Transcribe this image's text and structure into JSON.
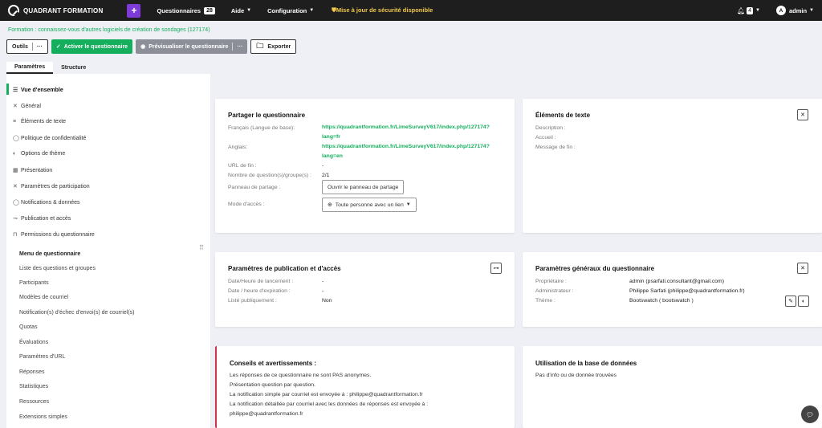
{
  "topbar": {
    "brand": "QUADRANT FORMATION",
    "plus": "+",
    "surveys_label": "Questionnaires",
    "surveys_count": "28",
    "help_label": "Aide",
    "config_label": "Configuration",
    "alert": "Mise à jour de sécurité disponible",
    "bell_count": "4",
    "user_initial": "A",
    "user": "admin"
  },
  "breadcrumb": "Formation : connaissez-vous d'autres logiciels de création de sondages (127174)",
  "toolbar": {
    "tools": "Outils",
    "activate": "Activer le questionnaire",
    "preview": "Prévisualiser le questionnaire",
    "more": "···",
    "export": "Exporter"
  },
  "tabs": [
    "Paramètres",
    "Structure"
  ],
  "sidebar": {
    "items": [
      "Vue d'ensemble",
      "Général",
      "Éléments de texte",
      "Politique de confidentialité",
      "Options de thème",
      "Présentation",
      "Paramètres de participation",
      "Notifications & données",
      "Publication et accès",
      "Permissions du questionnaire"
    ],
    "menu_title": "Menu de questionnaire",
    "menu_items": [
      "Liste des questions et groupes",
      "Participants",
      "Modèles de courriel",
      "Notification(s) d'échec d'envoi(s) de courriel(s)",
      "Quotas",
      "Évaluations",
      "Paramètres d'URL",
      "Réponses",
      "Statistiques",
      "Ressources",
      "Extensions simples"
    ]
  },
  "share": {
    "title": "Partager le questionnaire",
    "fr_label": "Français (Langue de base):",
    "fr_url1": "https://quadrantformation.fr/LimeSurveyV617/index.php/127174?",
    "fr_url2": "lang=fr",
    "en_label": "Anglais:",
    "en_url1": "https://quadrantformation.fr/LimeSurveyV617/index.php/127174?",
    "en_url2": "lang=en",
    "end_url_label": "URL de fin :",
    "end_url": "-",
    "count_label": "Nombre de question(s)/groupe(s) :",
    "count": "2/1",
    "panel_label": "Panneau de partage :",
    "panel_btn": "Ouvrir le panneau de partage",
    "access_label": "Mode d'accès :",
    "access_value": "Toute personne avec un lien"
  },
  "texts": {
    "title": "Éléments de texte",
    "desc": "Description :",
    "welcome": "Accueil :",
    "end": "Message de fin :"
  },
  "publish": {
    "title": "Paramètres de publication et d'accès",
    "start_label": "Date/Heure de lancement :",
    "start": "-",
    "expiry_label": "Date / heure d'expiration :",
    "expiry": "-",
    "public_label": "Listé publiquement :",
    "public": "Non"
  },
  "general": {
    "title": "Paramètres généraux du questionnaire",
    "owner_label": "Propriétaire :",
    "owner": "admin (psarfati.consultant@gmail.com)",
    "admin_label": "Administrateur :",
    "admin": "Philippe Sarfati (philippe@quadrantformation.fr)",
    "theme_label": "Thème :",
    "theme": "Bootswatch ( bootswatch )"
  },
  "advice": {
    "title": "Conseils et avertissements :",
    "lines": [
      "Les réponses de ce questionnaire ne sont PAS anonymes.",
      "Présentation question par question.",
      "La notification simple par courriel est envoyée à : philippe@quadrantformation.fr",
      "La notification détaillée par courriel avec les données de réponses est envoyée à :",
      "philippe@quadrantformation.fr"
    ]
  },
  "db": {
    "title": "Utilisation de la base de données",
    "text": "Pas d'info ou de donnée trouvées"
  },
  "colors": {
    "green": "#14ae5c",
    "purple": "#7e3bd8",
    "alert": "#f2c94c",
    "red": "#d2344a"
  }
}
